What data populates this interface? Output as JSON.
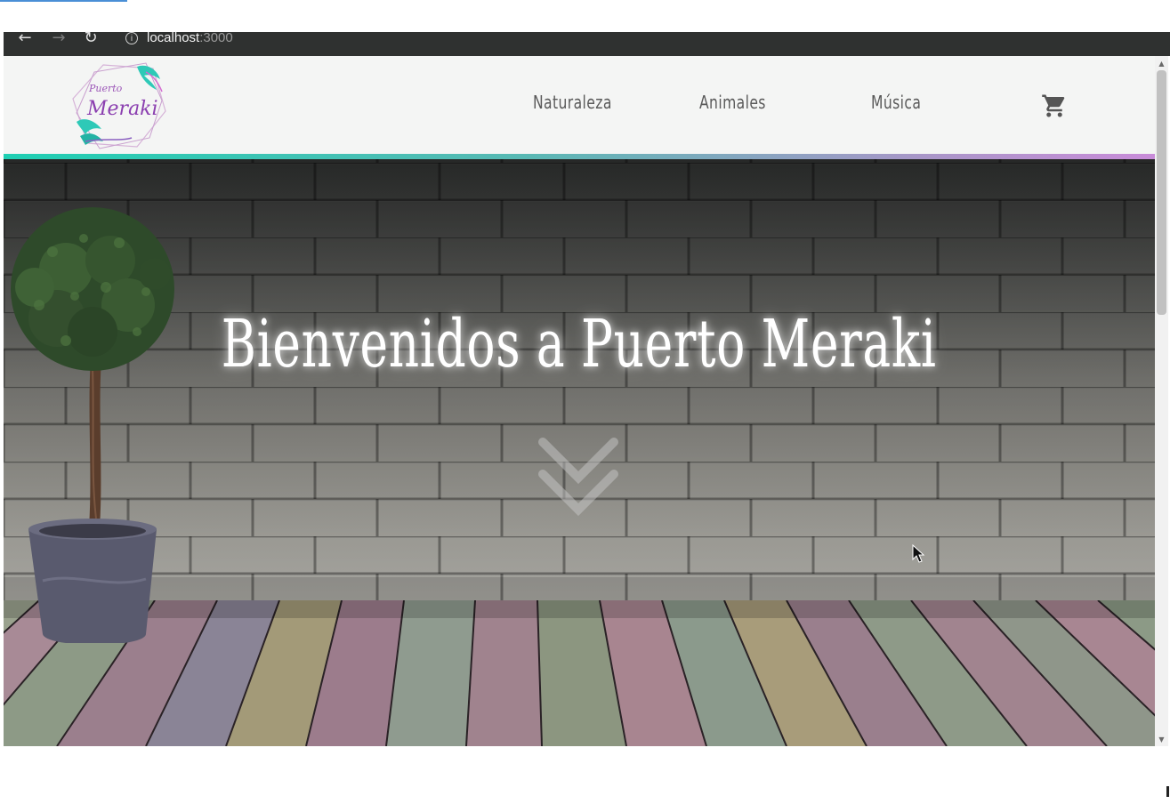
{
  "browser": {
    "back_icon": "arrow-left-icon",
    "forward_icon": "arrow-right-icon",
    "reload_icon": "reload-icon",
    "info_icon": "info-icon",
    "url_host": "localhost",
    "url_port": ":3000"
  },
  "header": {
    "logo_text_small": "Puerto",
    "logo_text_large": "Meraki",
    "nav": [
      {
        "label": "Naturaleza"
      },
      {
        "label": "Animales"
      },
      {
        "label": "Música"
      }
    ],
    "cart_icon": "cart-icon",
    "gradient_colors": [
      "#1fcfb3",
      "#58b9b4",
      "#a996c8",
      "#c98cd9"
    ]
  },
  "hero": {
    "title": "Bienvenidos a Puerto Meraki",
    "scroll_icon": "double-chevron-down-icon",
    "title_color": "#ffffff"
  }
}
